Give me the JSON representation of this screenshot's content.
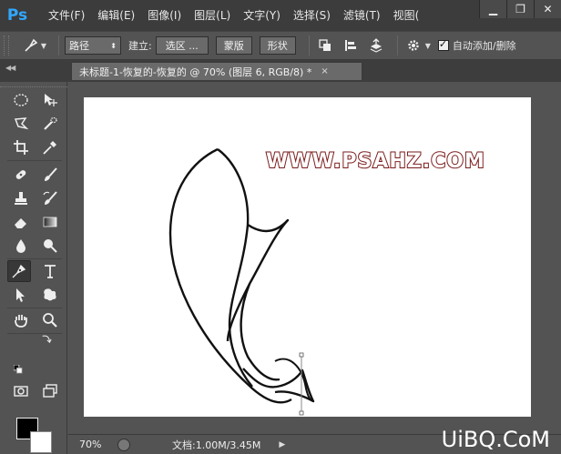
{
  "app": {
    "logo": "Ps"
  },
  "menu": [
    "文件(F)",
    "编辑(E)",
    "图像(I)",
    "图层(L)",
    "文字(Y)",
    "选择(S)",
    "滤镜(T)",
    "视图("
  ],
  "window_controls": {
    "minimize": "▁",
    "restore": "❐",
    "close": "✕"
  },
  "options": {
    "mode_select": "路径",
    "make_label": "建立:",
    "selection_button": "选区 ...",
    "mask_button": "蒙版",
    "shape_button": "形状",
    "auto_add_delete_label": "自动添加/删除",
    "auto_add_delete_checked": true
  },
  "document": {
    "tab_title": "未标题-1-恢复的-恢复的 @ 70% (图层 6, RGB/8) *",
    "tab_close": "×",
    "watermark_text": "WWW.PSAHZ.COM"
  },
  "status": {
    "zoom": "70%",
    "doc_info": "文档:1.00M/3.45M",
    "more_arrow": "▶"
  },
  "site_watermark": "UiBQ.CoM",
  "colors": {
    "foreground": "#000000",
    "background": "#ffffff",
    "accent": "#31a8ff"
  },
  "icons": [
    "pen-icon",
    "gear-icon",
    "marquee-icon",
    "move-icon",
    "lasso-icon",
    "quick-select-icon",
    "crop-icon",
    "eyedropper-icon",
    "healing-brush-icon",
    "brush-icon",
    "stamp-icon",
    "history-brush-icon",
    "eraser-icon",
    "gradient-icon",
    "blur-icon",
    "dodge-icon",
    "pen-tool-icon",
    "type-icon",
    "path-select-icon",
    "shape-icon",
    "hand-icon",
    "zoom-icon",
    "quick-mask-icon",
    "screen-mode-icon"
  ]
}
